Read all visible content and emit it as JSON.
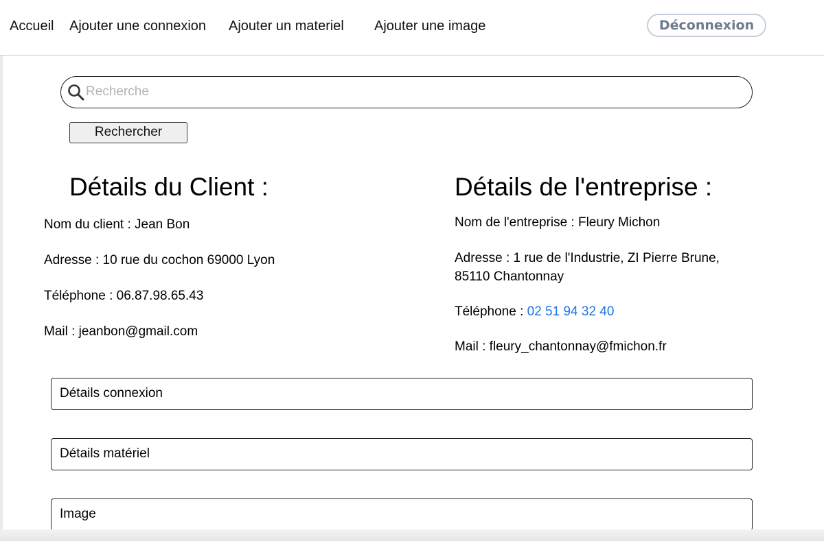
{
  "nav": {
    "home": "Accueil",
    "add_connection": "Ajouter une connexion",
    "add_material": "Ajouter un materiel",
    "add_image": "Ajouter une image",
    "logout": "Déconnexion"
  },
  "search": {
    "placeholder": "Recherche",
    "value": "",
    "button_label": "Rechercher"
  },
  "client": {
    "title": "Détails du Client :",
    "name": "Nom du client : Jean Bon",
    "address": "Adresse : 10 rue du cochon 69000 Lyon",
    "phone": "Téléphone : 06.87.98.65.43",
    "mail": "Mail : jeanbon@gmail.com"
  },
  "company": {
    "title": "Détails de l'entreprise :",
    "name": "Nom de l'entreprise : Fleury Michon",
    "address": "Adresse : 1 rue de l'Industrie, ZI Pierre Brune, 85110 Chantonnay",
    "phone_label": "Téléphone : ",
    "phone_number": "02 51 94 32 40",
    "mail": "Mail : fleury_chantonnay@fmichon.fr"
  },
  "panels": [
    {
      "label": "Détails connexion"
    },
    {
      "label": "Détails matériel"
    },
    {
      "label": "Image"
    }
  ],
  "colors": {
    "link_blue": "#1b74e4",
    "logout_text": "#6f7b8b",
    "logout_border": "#c5cdd8"
  }
}
